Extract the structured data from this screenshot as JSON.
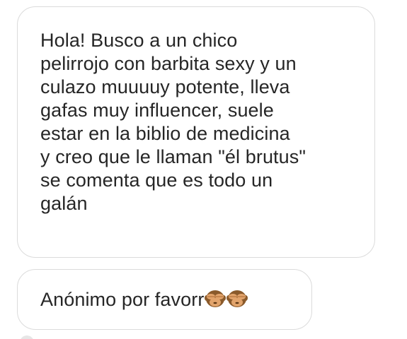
{
  "messages": [
    {
      "lines": [
        "Hola! Busco a un chico",
        "pelirrojo con barbita sexy y un",
        "culazo muuuuy potente, lleva",
        "gafas muy influencer, suele",
        "estar en la biblio de medicina",
        "y creo que le llaman \"él brutus\"",
        "se comenta que es todo un",
        "galán"
      ]
    },
    {
      "text": "Anónimo por favorr",
      "emoji": [
        "see-no-evil-monkey-icon",
        "see-no-evil-monkey-icon"
      ]
    }
  ],
  "colors": {
    "bubble_border": "#dbdbdb",
    "text": "#262626",
    "monkey_face": "#8a5a2b",
    "monkey_hands": "#e2a46c"
  }
}
